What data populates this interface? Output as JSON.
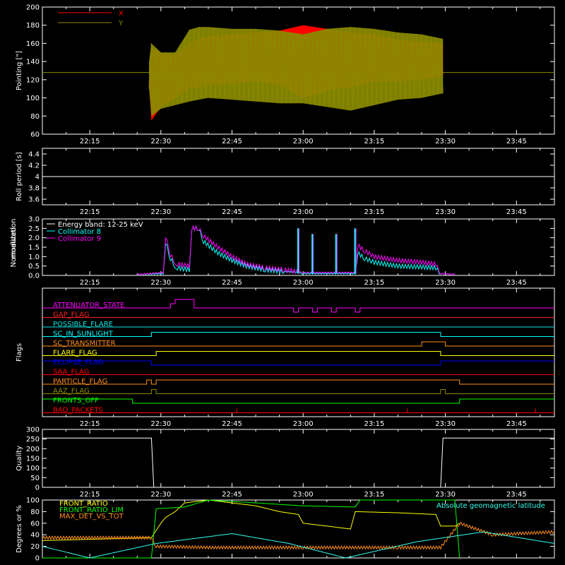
{
  "time_ticks": [
    "22:15",
    "22:30",
    "22:45",
    "23:00",
    "23:15",
    "23:30",
    "23:45"
  ],
  "colors": {
    "background": "#000000",
    "axes": "#ffffff",
    "red": "#ff0000",
    "olive": "#8a8a00",
    "cyan": "#00ffff",
    "magenta": "#ff00ff",
    "orange": "#ff8c1a",
    "yellow": "#ffff00",
    "green": "#00ff00",
    "blue": "#0000ff",
    "light_cyan": "#33ffee",
    "white": "#ffffff"
  },
  "chart_data": [
    {
      "id": "pointing",
      "type": "line",
      "ylabel": "Pointing [\"]",
      "ylim": [
        60,
        200
      ],
      "yticks": [
        60,
        80,
        100,
        120,
        140,
        160,
        180,
        200
      ],
      "xlim": [
        "22:05",
        "23:53"
      ],
      "legend_placement": "top-left",
      "series": [
        {
          "name": "X",
          "color": "#ff0000",
          "envelope": {
            "x": [
              "22:27.5",
              "22:28",
              "22:30",
              "22:33",
              "22:36",
              "22:38",
              "22:40",
              "22:45",
              "22:50",
              "22:55",
              "23:00",
              "23:05",
              "23:10",
              "23:15",
              "23:20",
              "23:25",
              "23:29.5"
            ],
            "upper": [
              135,
              155,
              150,
              148,
              160,
              165,
              168,
              170,
              172,
              174,
              180,
              176,
              172,
              170,
              164,
              162,
              160
            ],
            "lower": [
              115,
              75,
              90,
              100,
              110,
              112,
              115,
              116,
              118,
              115,
              100,
              108,
              112,
              118,
              118,
              120,
              125
            ]
          }
        },
        {
          "name": "Y",
          "color": "#8a8a00",
          "envelope": {
            "x": [
              "22:27.5",
              "22:28",
              "22:30",
              "22:33",
              "22:36",
              "22:38",
              "22:40",
              "22:45",
              "22:50",
              "22:55",
              "23:00",
              "23:05",
              "23:10",
              "23:15",
              "23:20",
              "23:25",
              "23:29.5"
            ],
            "upper": [
              140,
              160,
              150,
              150,
              175,
              178,
              178,
              176,
              176,
              174,
              170,
              176,
              178,
              176,
              172,
              170,
              165
            ],
            "lower": [
              110,
              80,
              88,
              92,
              96,
              98,
              100,
              98,
              96,
              94,
              94,
              90,
              86,
              92,
              98,
              100,
              105
            ]
          }
        }
      ],
      "baseline": {
        "value": 128,
        "color": "#8a8a00"
      }
    },
    {
      "id": "roll_period",
      "type": "line",
      "ylabel": "Roll period [s]",
      "ylim": [
        3.5,
        4.5
      ],
      "yticks": [
        3.6,
        3.8,
        4.0,
        4.2,
        4.4
      ],
      "series": [
        {
          "color": "#ffffff",
          "x": [
            "22:05",
            "23:53"
          ],
          "y": [
            4.0,
            4.0
          ]
        }
      ]
    },
    {
      "id": "modulation",
      "type": "line",
      "ylabel": "Normalized modulation",
      "ylim": [
        0,
        3.0
      ],
      "yticks": [
        "0.0",
        "0.5",
        "1.0",
        "1.5",
        "2.0",
        "2.5",
        "3.0"
      ],
      "legend_placement": "top-left",
      "series": [
        {
          "name": "Energy band: 12-25 keV",
          "color": "#ffffff"
        },
        {
          "name": "Collimator 8",
          "color": "#00ffff",
          "x": [
            "22:25",
            "22:30.5",
            "22:31",
            "22:32",
            "22:33",
            "22:33.5",
            "22:36",
            "22:36.5",
            "22:38",
            "22:39",
            "22:42",
            "22:45",
            "22:48",
            "22:52",
            "22:56",
            "22:59",
            "23:00",
            "23:02",
            "23:05",
            "23:08",
            "23:11",
            "23:11.5",
            "23:13",
            "23:15",
            "23:20",
            "23:25",
            "23:28",
            "23:29",
            "23:32"
          ],
          "y": [
            0.05,
            0.1,
            1.8,
            0.9,
            0.5,
            0.4,
            0.3,
            2.5,
            2.5,
            1.8,
            1.2,
            0.8,
            0.5,
            0.3,
            0.2,
            0.15,
            0.1,
            0.1,
            0.1,
            0.1,
            0.1,
            1.2,
            0.9,
            0.7,
            0.5,
            0.45,
            0.4,
            0.1,
            0.05
          ]
        },
        {
          "name": "Collimator 9",
          "color": "#ff00ff",
          "x": [
            "22:25",
            "22:30.5",
            "22:31",
            "22:32",
            "22:33",
            "22:33.5",
            "22:36",
            "22:36.5",
            "22:38",
            "22:39",
            "22:42",
            "22:45",
            "22:48",
            "22:52",
            "22:56",
            "22:59",
            "23:00",
            "23:02",
            "23:05",
            "23:08",
            "23:11",
            "23:11.5",
            "23:13",
            "23:15",
            "23:20",
            "23:25",
            "23:28",
            "23:29",
            "23:32"
          ],
          "y": [
            0.05,
            0.15,
            2.1,
            1.1,
            0.7,
            0.6,
            0.5,
            2.5,
            2.5,
            2.1,
            1.5,
            1.0,
            0.6,
            0.4,
            0.3,
            0.2,
            0.15,
            0.15,
            0.15,
            0.15,
            0.15,
            1.6,
            1.3,
            1.0,
            0.8,
            0.7,
            0.6,
            0.1,
            0.05
          ]
        }
      ],
      "spikes": [
        {
          "x": "22:59",
          "y": 2.5
        },
        {
          "x": "23:02",
          "y": 2.2
        },
        {
          "x": "23:07",
          "y": 2.2
        },
        {
          "x": "23:11",
          "y": 2.5
        }
      ]
    },
    {
      "id": "flags",
      "type": "line",
      "ylabel": "Flags",
      "series": [
        {
          "name": "ATTENUATOR_STATE",
          "color": "#ff00ff",
          "transitions": [
            [
              "22:05",
              0
            ],
            [
              "22:32",
              1
            ],
            [
              "22:33",
              2
            ],
            [
              "22:37",
              0
            ],
            [
              "22:58",
              -1
            ],
            [
              "22:59",
              0
            ],
            [
              "23:02",
              -1
            ],
            [
              "23:03",
              0
            ],
            [
              "23:06",
              -1
            ],
            [
              "23:07",
              0
            ],
            [
              "23:11",
              -1
            ],
            [
              "23:12",
              0
            ],
            [
              "23:53",
              0
            ]
          ]
        },
        {
          "name": "GAP_FLAG",
          "color": "#ff2222",
          "transitions": [
            [
              "22:05",
              0
            ],
            [
              "23:53",
              0
            ]
          ]
        },
        {
          "name": "POSSIBLE_FLARE",
          "color": "#00e5e5",
          "transitions": [
            [
              "22:05",
              0
            ],
            [
              "23:53",
              0
            ]
          ]
        },
        {
          "name": "SC_IN_SUNLIGHT",
          "color": "#00ffff",
          "transitions": [
            [
              "22:05",
              0
            ],
            [
              "22:28",
              1
            ],
            [
              "23:29",
              0
            ],
            [
              "23:53",
              0
            ]
          ]
        },
        {
          "name": "SC_TRANSMITTER",
          "color": "#ff8c1a",
          "transitions": [
            [
              "22:05",
              0
            ],
            [
              "23:25",
              1
            ],
            [
              "23:30",
              0
            ],
            [
              "23:53",
              0
            ]
          ]
        },
        {
          "name": "FLARE_FLAG",
          "color": "#ffff00",
          "transitions": [
            [
              "22:05",
              0
            ],
            [
              "22:29",
              1
            ],
            [
              "23:29",
              0
            ],
            [
              "23:53",
              0
            ]
          ]
        },
        {
          "name": "ECLIPSE_FLAG",
          "color": "#0000ff",
          "transitions": [
            [
              "22:05",
              1
            ],
            [
              "22:28",
              0
            ],
            [
              "23:29",
              1
            ],
            [
              "23:53",
              1
            ]
          ]
        },
        {
          "name": "SAA_FLAG",
          "color": "#ff0000",
          "transitions": [
            [
              "22:05",
              0
            ],
            [
              "23:53",
              0
            ]
          ]
        },
        {
          "name": "PARTICLE_FLAG",
          "color": "#ff8c1a",
          "transitions": [
            [
              "22:05",
              0
            ],
            [
              "22:27",
              1
            ],
            [
              "22:28",
              0
            ],
            [
              "22:29",
              1
            ],
            [
              "23:33",
              0
            ],
            [
              "23:53",
              0
            ]
          ]
        },
        {
          "name": "AAZ_FLAG",
          "color": "#8a8a00",
          "transitions": [
            [
              "22:05",
              0
            ],
            [
              "22:28",
              1
            ],
            [
              "22:29",
              0
            ],
            [
              "23:29",
              1
            ],
            [
              "23:30",
              0
            ],
            [
              "23:53",
              0
            ]
          ]
        },
        {
          "name": "FRONTS_OFF",
          "color": "#00ff00",
          "transitions": [
            [
              "22:05",
              1
            ],
            [
              "22:24",
              0
            ],
            [
              "23:33",
              1
            ],
            [
              "23:53",
              1
            ]
          ]
        },
        {
          "name": "BAD_PACKETS",
          "color": "#ff0000",
          "transitions": [
            [
              "22:05",
              0
            ],
            [
              "23:53",
              0
            ]
          ],
          "spikes": [
            "22:46",
            "23:22",
            "23:49"
          ]
        }
      ]
    },
    {
      "id": "quality",
      "type": "line",
      "ylabel": "Quality",
      "ylim": [
        0,
        300
      ],
      "yticks": [
        0,
        50,
        100,
        150,
        200,
        250,
        300
      ],
      "series": [
        {
          "color": "#ffffff",
          "x": [
            "22:05",
            "22:28",
            "22:28.5",
            "23:29",
            "23:29.5",
            "23:53"
          ],
          "y": [
            255,
            255,
            0,
            0,
            255,
            255
          ]
        }
      ]
    },
    {
      "id": "degrees",
      "type": "line",
      "ylabel": "Degrees or %",
      "ylim": [
        0,
        100
      ],
      "yticks": [
        0,
        20,
        40,
        60,
        80,
        100
      ],
      "series": [
        {
          "name": "FRONT_RATIO",
          "color": "#ffff00",
          "x": [
            "22:05",
            "22:28",
            "22:30",
            "22:31",
            "22:33",
            "22:35",
            "22:40",
            "22:45",
            "22:50",
            "22:55",
            "22:59",
            "23:00",
            "23:05",
            "23:10",
            "23:11",
            "23:20",
            "23:28",
            "23:29",
            "23:32",
            "23:33"
          ],
          "y": [
            30,
            35,
            60,
            70,
            80,
            95,
            100,
            95,
            90,
            80,
            75,
            60,
            55,
            50,
            80,
            78,
            75,
            55,
            55,
            60
          ]
        },
        {
          "name": "FRONT_RATIO_LIM",
          "color": "#00ff00",
          "x": [
            "22:05",
            "22:28",
            "22:29",
            "22:35",
            "22:40",
            "23:00",
            "23:11",
            "23:12",
            "23:28",
            "23:29",
            "23:32",
            "23:33"
          ],
          "y": [
            0,
            0,
            85,
            88,
            100,
            90,
            88,
            100,
            100,
            100,
            100,
            0
          ]
        },
        {
          "name": "MAX_DET_VS_TOT",
          "color": "#ff8c1a",
          "x": [
            "22:05",
            "22:28",
            "22:29",
            "22:40",
            "23:00",
            "23:20",
            "23:29",
            "23:33",
            "23:40",
            "23:53"
          ],
          "y": [
            35,
            35,
            20,
            18,
            18,
            18,
            18,
            60,
            40,
            45
          ]
        },
        {
          "name": "Absolute geomagnetic latitude",
          "color": "#33ffee",
          "x": [
            "22:05",
            "22:15",
            "22:29",
            "22:45",
            "22:57",
            "23:09",
            "23:24",
            "23:38",
            "23:53"
          ],
          "y": [
            20,
            0,
            25,
            42,
            25,
            0,
            28,
            45,
            25
          ]
        }
      ]
    }
  ]
}
